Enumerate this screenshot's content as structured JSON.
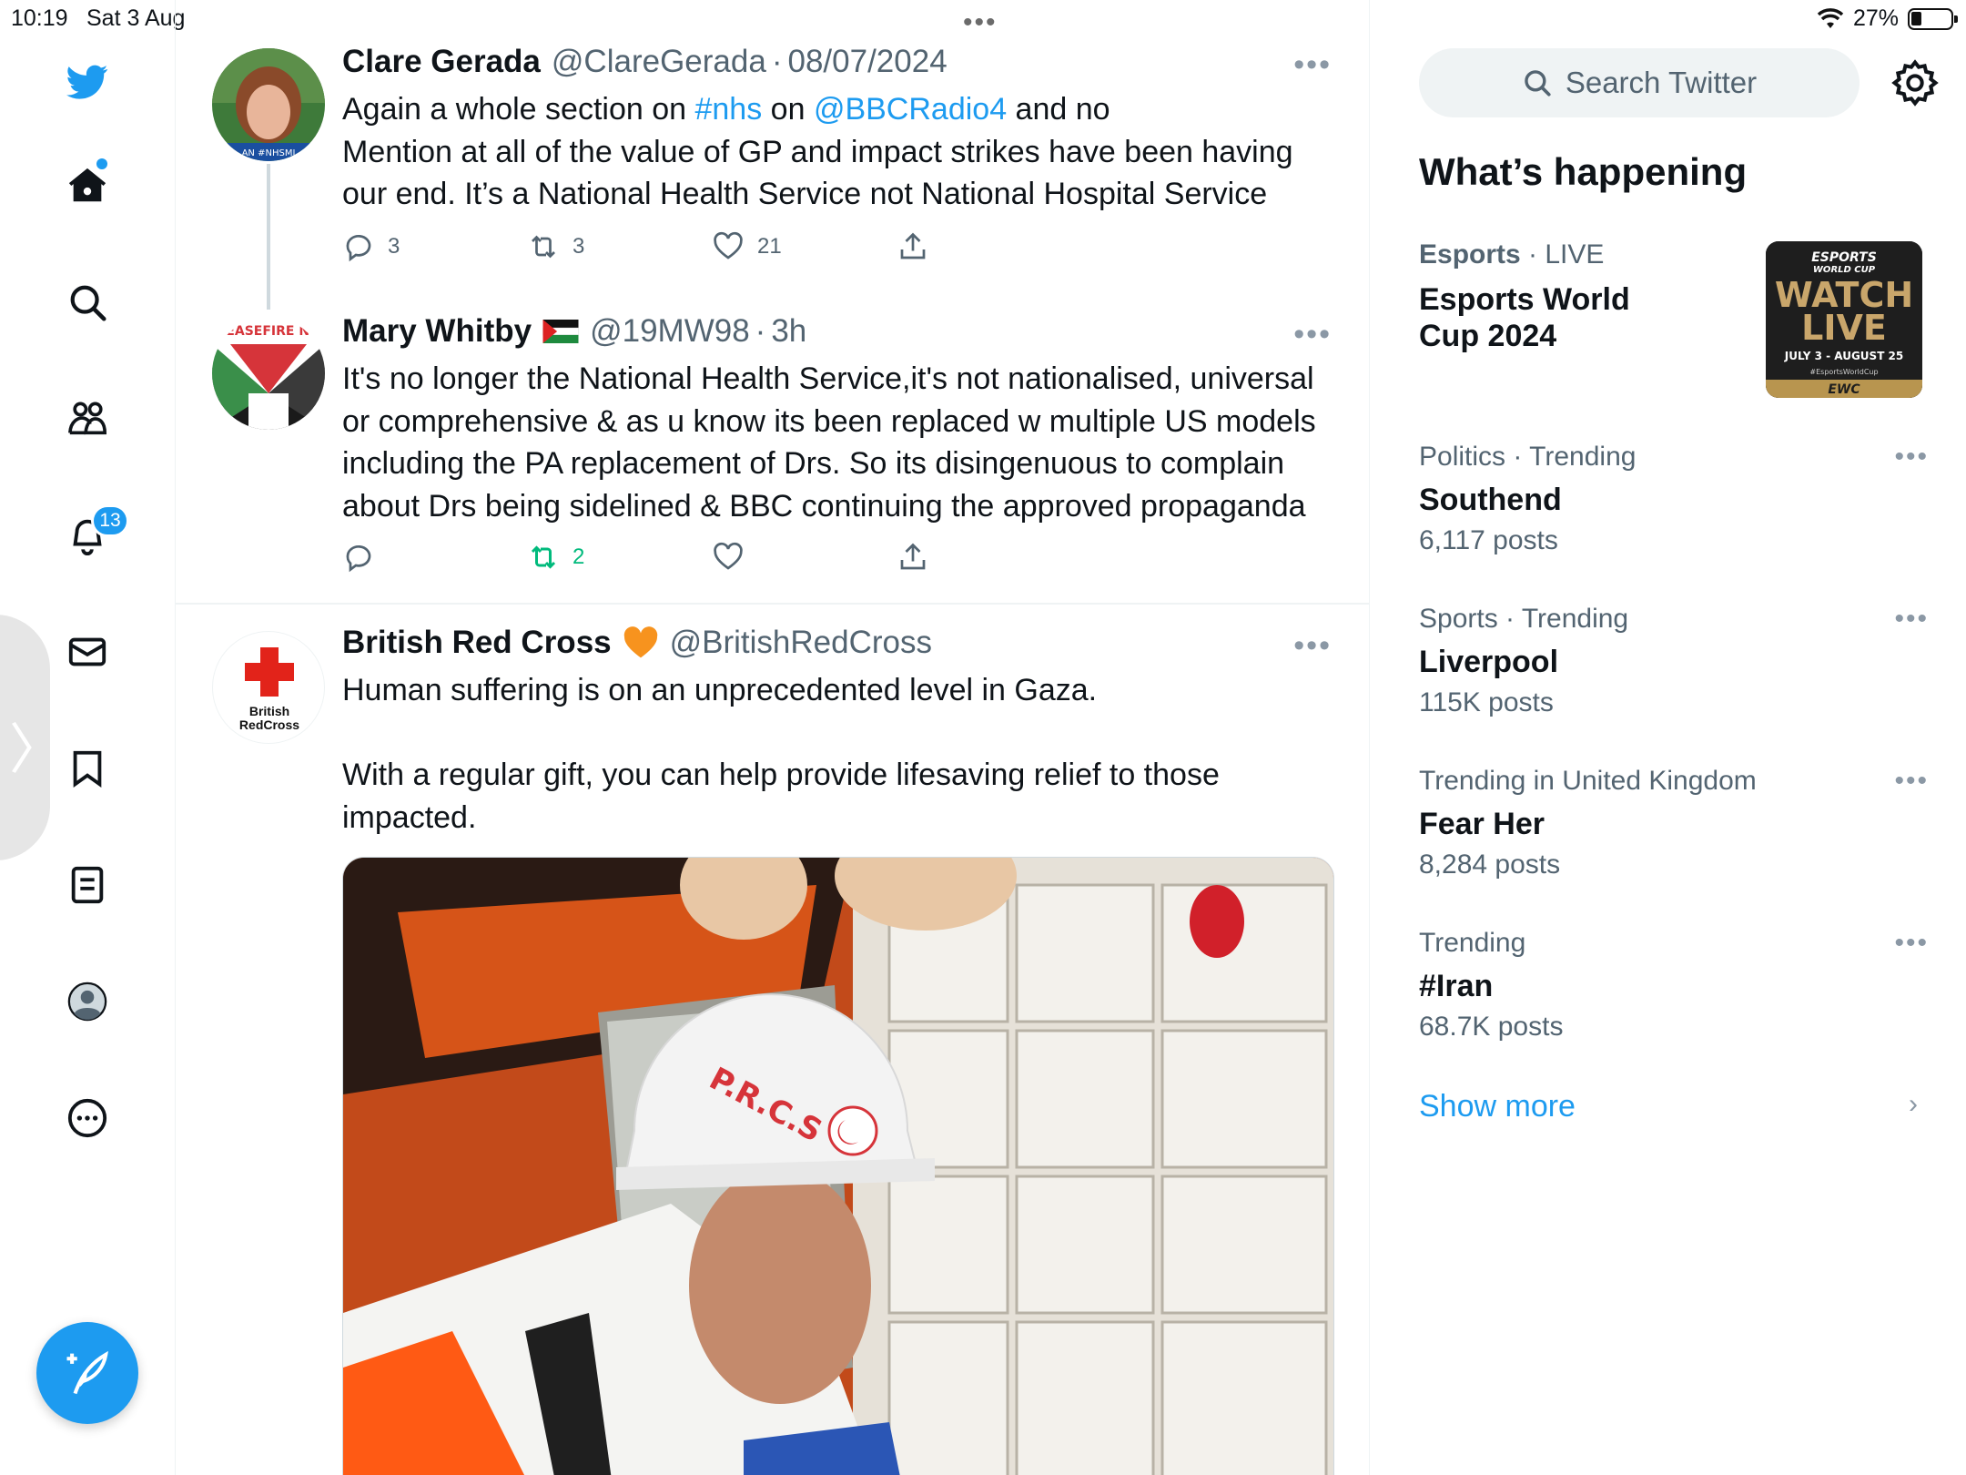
{
  "status_bar": {
    "time": "10:19",
    "date": "Sat 3 Aug",
    "battery": "27%"
  },
  "nav": {
    "notifications_badge": "13",
    "items": [
      "twitter-logo",
      "home",
      "explore",
      "communities",
      "notifications",
      "messages",
      "bookmarks",
      "lists",
      "profile",
      "more"
    ]
  },
  "tweets": [
    {
      "name": "Clare Gerada",
      "handle": "@ClareGerada",
      "date": "08/07/2024",
      "text_parts": [
        "Again a whole section on ",
        "#nhs",
        " on ",
        "@BBCRadio4",
        " and no"
      ],
      "text_lines": [
        "Mention at all of the value of GP and impact strikes have been having",
        "our end. It’s a National Health Service not National Hospital Service"
      ],
      "avatar_caption": "AN #NHSMI",
      "replies": "3",
      "retweets": "3",
      "likes": "21"
    },
    {
      "name": "Mary Whitby",
      "handle": "@19MW98",
      "date": "3h",
      "text_lines": [
        "It's no longer the National Health Service,it's not nationalised, universal",
        "or comprehensive & as u know its been replaced w multiple US models",
        "including the PA replacement of Drs. So its disingenuous to complain",
        "about Drs being sidelined & BBC continuing the approved propaganda"
      ],
      "avatar_caption": "CEASEFIRE NO",
      "retweets": "2"
    },
    {
      "name": "British Red Cross",
      "handle": "@BritishRedCross",
      "text_line1": "Human suffering is on an unprecedented level in Gaza.",
      "text_lines": [
        "With a regular gift, you can help provide lifesaving relief to those",
        "impacted."
      ],
      "avatar_caption_1": "British",
      "avatar_caption_2": "RedCross",
      "image_labels": {
        "helmet": "P.R.C.S"
      }
    }
  ],
  "right": {
    "search_placeholder": "Search Twitter",
    "section_title": "What’s happening",
    "trends": [
      {
        "category": "Esports",
        "extra": "LIVE",
        "name_line1": "Esports World",
        "name_line2": "Cup 2024"
      },
      {
        "category": "Politics · Trending",
        "name": "Southend",
        "count": "6,117 posts"
      },
      {
        "category": "Sports · Trending",
        "name": "Liverpool",
        "count": "115K posts"
      },
      {
        "category": "Trending in United Kingdom",
        "name": "Fear Her",
        "count": "8,284 posts"
      },
      {
        "category": "Trending",
        "name": "#Iran",
        "count": "68.7K posts"
      }
    ],
    "esports_image": {
      "line1": "ESPORTS",
      "line2": "WORLD CUP",
      "line3": "WATCH",
      "line4": "LIVE",
      "dates": "JULY 3 - AUGUST 25",
      "hashtag": "#EsportsWorldCup",
      "footer": "EWC"
    },
    "show_more": "Show more"
  },
  "colors": {
    "accent": "#1d9bf0",
    "retweet_green": "#00ba7c",
    "text_secondary": "#536471"
  },
  "icons": [
    "twitter-bird-icon",
    "home-icon",
    "search-icon",
    "communities-icon",
    "bell-icon",
    "mail-icon",
    "bookmark-icon",
    "list-icon",
    "profile-icon",
    "more-icon",
    "compose-icon",
    "reply-icon",
    "retweet-icon",
    "like-icon",
    "share-icon",
    "gear-icon",
    "chevron-right-icon",
    "wifi-icon",
    "battery-icon"
  ]
}
